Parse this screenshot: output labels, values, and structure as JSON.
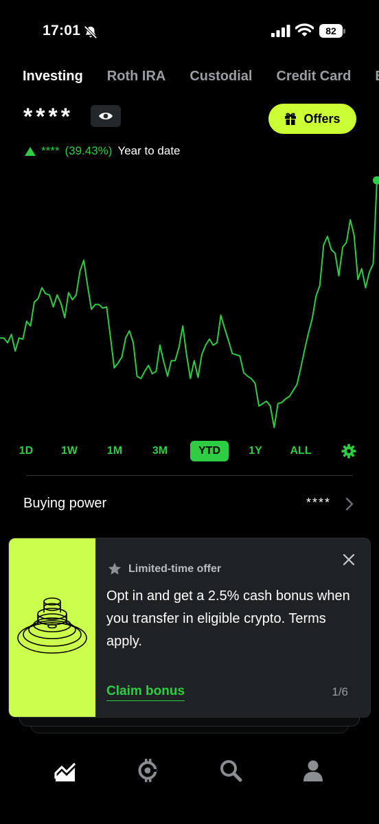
{
  "status_bar": {
    "time": "17:01",
    "battery": "82"
  },
  "tabs": [
    {
      "label": "Investing",
      "active": true
    },
    {
      "label": "Roth IRA",
      "active": false
    },
    {
      "label": "Custodial",
      "active": false
    },
    {
      "label": "Credit Card",
      "active": false
    },
    {
      "label": "Ba",
      "active": false
    }
  ],
  "portfolio": {
    "balance": "****",
    "change_amount": "****",
    "change_percent": "(39.43%)",
    "change_period": "Year to date",
    "offers_label": "Offers",
    "accent_color": "#2fcd44",
    "highlight_color": "#ccff33"
  },
  "chart_data": {
    "type": "line",
    "x_range": "YTD",
    "title": "",
    "xlabel": "",
    "ylabel": "",
    "values": [
      100.0,
      100.0,
      99.6,
      100.3,
      98.9,
      100.0,
      99.9,
      101.4,
      101.0,
      103.0,
      103.3,
      104.2,
      103.7,
      103.6,
      102.6,
      103.6,
      102.9,
      101.7,
      103.8,
      103.2,
      103.6,
      105.6,
      106.5,
      104.4,
      102.4,
      102.8,
      102.8,
      102.5,
      102.6,
      100.1,
      97.5,
      97.9,
      98.4,
      100.0,
      100.6,
      99.6,
      96.8,
      96.6,
      97.2,
      97.7,
      97.0,
      97.2,
      99.4,
      98.0,
      96.8,
      98.1,
      98.1,
      99.2,
      101.0,
      98.6,
      96.6,
      98.1,
      96.7,
      98.6,
      99.4,
      99.9,
      99.4,
      99.6,
      101.9,
      100.8,
      99.8,
      98.7,
      98.6,
      98.5,
      97.1,
      96.8,
      96.6,
      96.2,
      94.3,
      94.5,
      94.7,
      94.3,
      92.5,
      94.5,
      94.6,
      94.9,
      95.1,
      95.6,
      96.1,
      97.5,
      99.0,
      100.4,
      101.6,
      103.5,
      104.4,
      107.8,
      108.5,
      107.4,
      107.1,
      105.2,
      107.6,
      108.0,
      109.9,
      108.6,
      104.9,
      105.8,
      104.2,
      105.5,
      106.2,
      113.2
    ],
    "ylim": [
      91.5,
      114.5
    ],
    "grid": false,
    "line_color": "#2fcd44"
  },
  "ranges": [
    {
      "label": "1D",
      "active": false
    },
    {
      "label": "1W",
      "active": false
    },
    {
      "label": "1M",
      "active": false
    },
    {
      "label": "3M",
      "active": false
    },
    {
      "label": "YTD",
      "active": true
    },
    {
      "label": "1Y",
      "active": false
    },
    {
      "label": "ALL",
      "active": false
    }
  ],
  "buying_power": {
    "label": "Buying power",
    "value": "****"
  },
  "offer_card": {
    "badge": "Limited-time offer",
    "text": "Opt in and get a 2.5% cash bonus when you transfer in eligible crypto. Terms apply.",
    "cta": "Claim bonus",
    "pager": "1/6",
    "art_color": "#ccff4d"
  },
  "bottom_nav": [
    {
      "icon": "investing-chart-icon",
      "active": true
    },
    {
      "icon": "crypto-icon",
      "active": false
    },
    {
      "icon": "search-icon",
      "active": false
    },
    {
      "icon": "account-icon",
      "active": false
    }
  ]
}
